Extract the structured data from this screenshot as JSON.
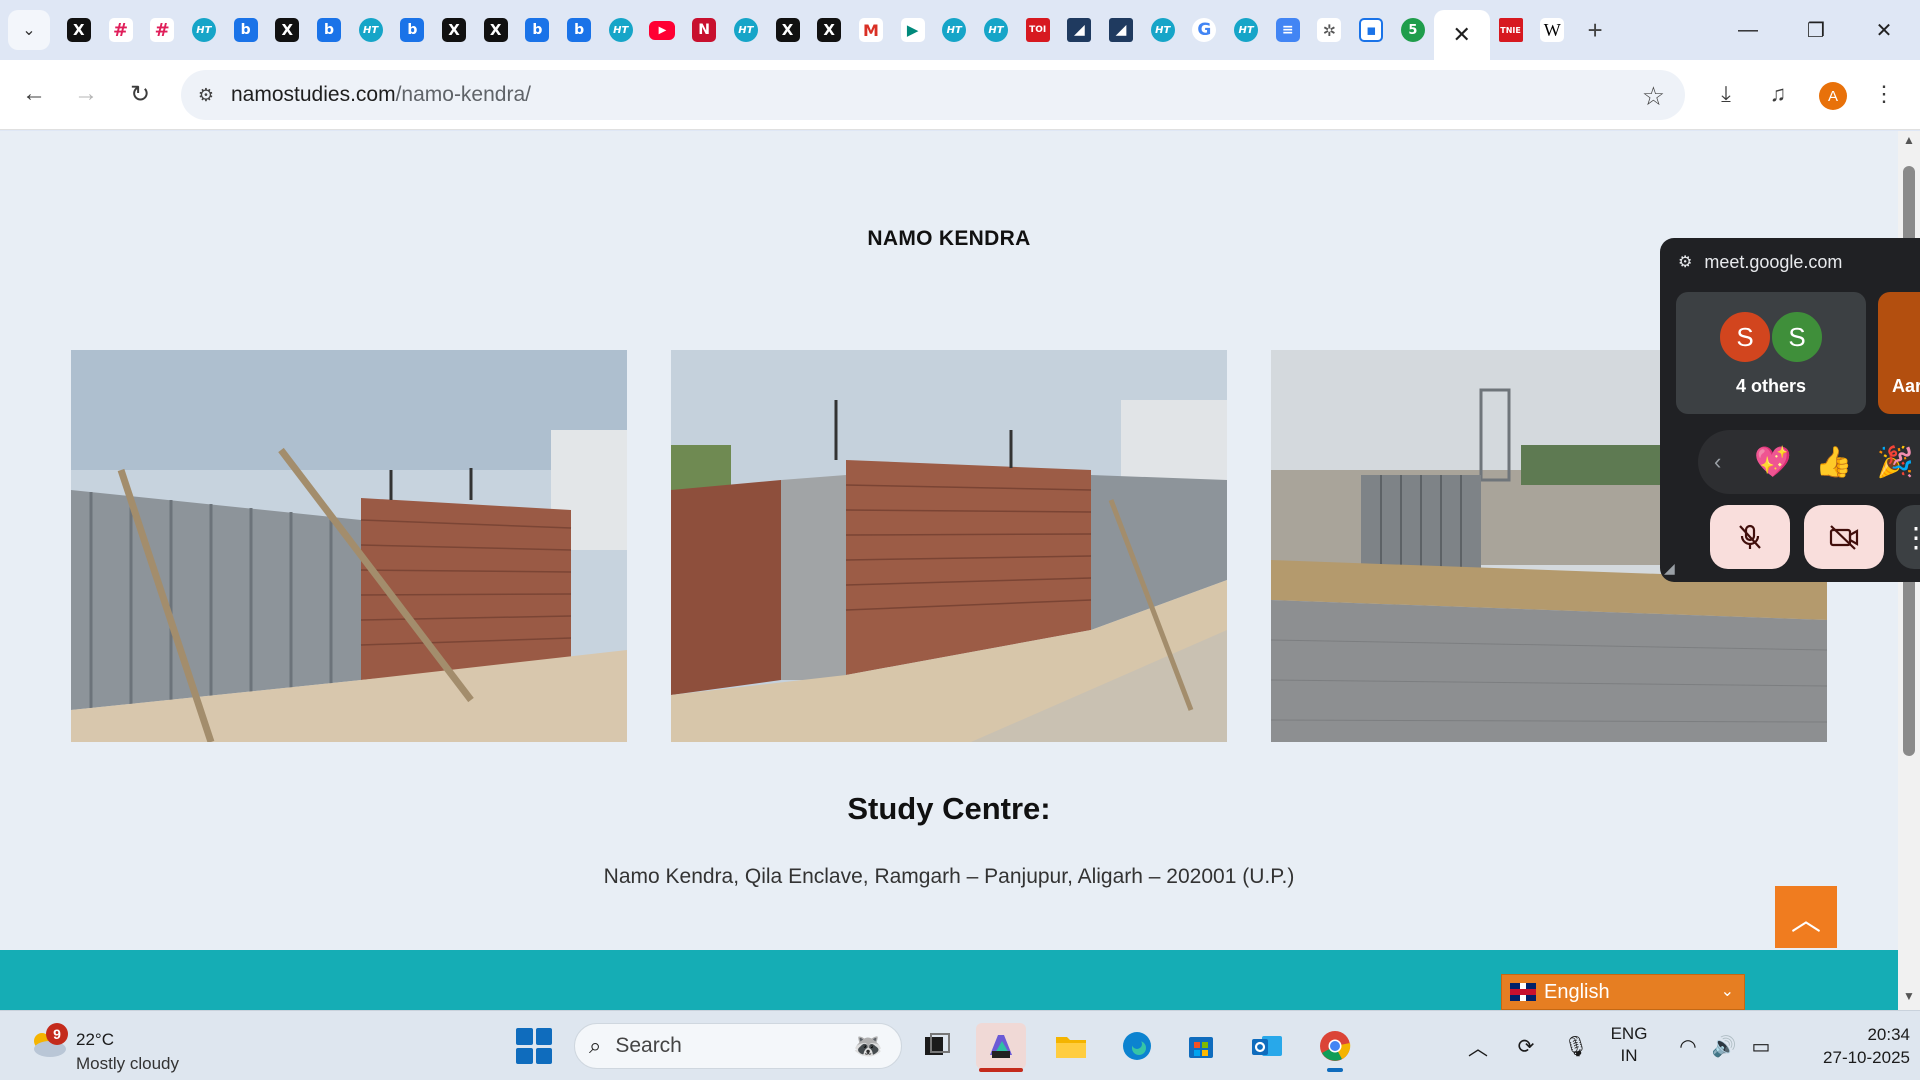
{
  "browser": {
    "tabs": [
      {
        "icon": "x-icon",
        "glyph": "X",
        "cls": "x"
      },
      {
        "icon": "slack-icon",
        "glyph": "#",
        "cls": "sl"
      },
      {
        "icon": "slack-icon",
        "glyph": "#",
        "cls": "sl"
      },
      {
        "icon": "ht-icon",
        "glyph": "HT",
        "cls": "ht"
      },
      {
        "icon": "b-icon",
        "glyph": "b",
        "cls": "b"
      },
      {
        "icon": "x-icon",
        "glyph": "X",
        "cls": "x"
      },
      {
        "icon": "b-icon",
        "glyph": "b",
        "cls": "b"
      },
      {
        "icon": "ht-icon",
        "glyph": "HT",
        "cls": "ht"
      },
      {
        "icon": "b-icon",
        "glyph": "b",
        "cls": "b"
      },
      {
        "icon": "x-icon",
        "glyph": "X",
        "cls": "x"
      },
      {
        "icon": "x-icon",
        "glyph": "X",
        "cls": "x"
      },
      {
        "icon": "b-icon",
        "glyph": "b",
        "cls": "b"
      },
      {
        "icon": "b-icon",
        "glyph": "b",
        "cls": "b"
      },
      {
        "icon": "ht-icon",
        "glyph": "HT",
        "cls": "ht"
      },
      {
        "icon": "youtube-icon",
        "glyph": "▶",
        "cls": "yt"
      },
      {
        "icon": "n-icon",
        "glyph": "N",
        "cls": "nt"
      },
      {
        "icon": "ht-icon",
        "glyph": "HT",
        "cls": "ht"
      },
      {
        "icon": "x-icon",
        "glyph": "X",
        "cls": "x"
      },
      {
        "icon": "x-icon",
        "glyph": "X",
        "cls": "x"
      },
      {
        "icon": "gmail-icon",
        "glyph": "M",
        "cls": "gm"
      },
      {
        "icon": "meet-icon",
        "glyph": "▶",
        "cls": "meet"
      },
      {
        "icon": "ht-icon",
        "glyph": "HT",
        "cls": "ht"
      },
      {
        "icon": "ht-icon",
        "glyph": "HT",
        "cls": "ht"
      },
      {
        "icon": "toi-icon",
        "glyph": "TOI",
        "cls": "toi"
      },
      {
        "icon": "dark-tab-icon",
        "glyph": "◢",
        "cls": "dk"
      },
      {
        "icon": "dark-tab-icon",
        "glyph": "◢",
        "cls": "dk"
      },
      {
        "icon": "ht-icon",
        "glyph": "HT",
        "cls": "ht"
      },
      {
        "icon": "google-icon",
        "glyph": "G",
        "cls": "g"
      },
      {
        "icon": "ht-icon",
        "glyph": "HT",
        "cls": "ht"
      },
      {
        "icon": "docs-icon",
        "glyph": "≡",
        "cls": "doc"
      },
      {
        "icon": "ai-icon",
        "glyph": "✲",
        "cls": "ai"
      },
      {
        "icon": "pip-icon",
        "glyph": "▪",
        "cls": "pip"
      },
      {
        "icon": "five-icon",
        "glyph": "5",
        "cls": "five"
      }
    ],
    "active_tab_close": "✕",
    "tabs_after": [
      {
        "icon": "tnie-icon",
        "glyph": "TNIE",
        "cls": "tnie"
      },
      {
        "icon": "wikipedia-icon",
        "glyph": "W",
        "cls": "w"
      }
    ],
    "new_tab": "+",
    "url_host": "namostudies.com",
    "url_path": "/namo-kendra/",
    "profile_initial": "A"
  },
  "page": {
    "title": "NAMO KENDRA",
    "study_heading": "Study Centre:",
    "address": "Namo Kendra, Qila Enclave, Ramgarh – Panjupur, Aligarh – 202001 (U.P.)",
    "language": "English"
  },
  "meet": {
    "host": "meet.google.com",
    "avatar_1": "S",
    "avatar_2": "S",
    "others_label": "4 others",
    "participant_partial": "Aar",
    "avatar_1_color": "#d2451e",
    "avatar_2_color": "#3f8f3a",
    "reactions": [
      "💖",
      "👍",
      "🎉"
    ]
  },
  "taskbar": {
    "weather_badge": "9",
    "temperature": "22°C",
    "weather": "Mostly cloudy",
    "search_placeholder": "Search",
    "lang_line1": "ENG",
    "lang_line2": "IN",
    "time": "20:34",
    "date": "27-10-2025"
  }
}
